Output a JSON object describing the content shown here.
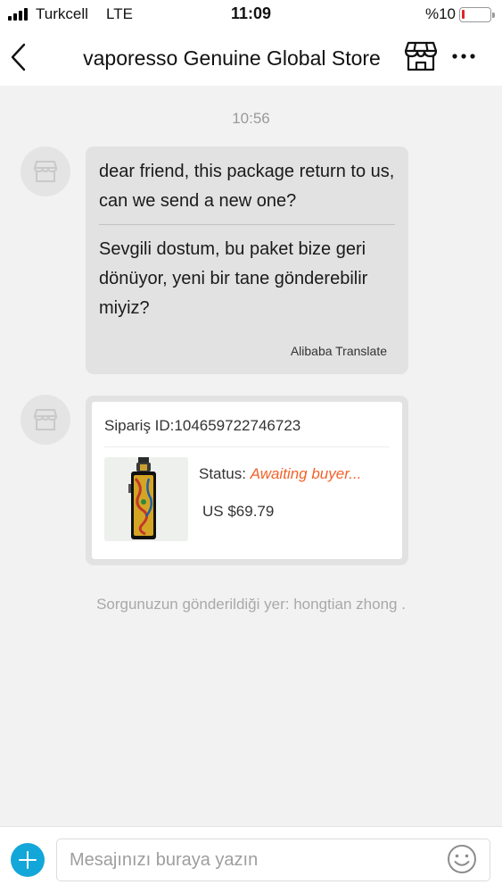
{
  "status_bar": {
    "carrier": "Turkcell",
    "network": "LTE",
    "time": "11:09",
    "battery_text": "%10",
    "battery_level": 0.1,
    "battery_color": "#e0252a"
  },
  "nav": {
    "back_icon": "chevron-left-icon",
    "title": "vaporesso Genuine Global Store",
    "store_icon": "store-icon",
    "more_icon": "more-horizontal-icon"
  },
  "chat": {
    "timestamp": "10:56",
    "message": {
      "original": "dear friend, this package return to us, can we send a new one?",
      "translated": "Sevgili dostum, bu paket bize geri dönüyor, yeni bir tane gönderebilir miyiz?",
      "translator": "Alibaba Translate"
    },
    "order_card": {
      "order_id_label": "Sipariş ID:104659722746723",
      "status_label": "Status:",
      "status_value": "Awaiting buyer...",
      "price": "US $69.79",
      "product_image": "vape-device-image"
    },
    "system_note": "Sorgunuzun gönderildiği yer: hongtian zhong ."
  },
  "input_bar": {
    "add_icon": "plus-circle-icon",
    "placeholder": "Mesajınızı buraya yazın",
    "value": "",
    "emoji_icon": "emoji-smile-icon"
  },
  "colors": {
    "accent": "#12a7d8",
    "status_orange": "#f2622a",
    "bubble_bg": "#e2e2e2",
    "chat_bg": "#f2f2f2"
  }
}
